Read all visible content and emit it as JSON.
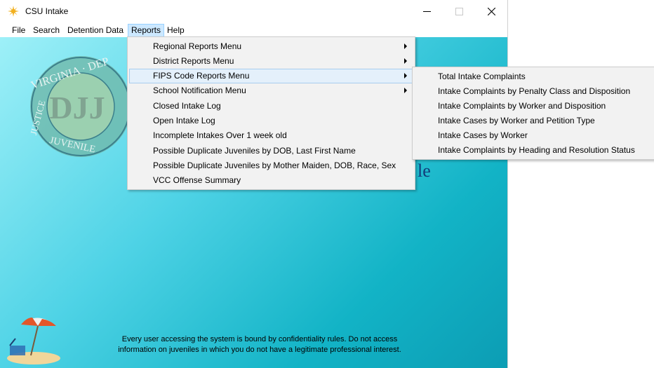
{
  "window": {
    "title": "CSU Intake",
    "minimize_glyph": "—",
    "maximize_glyph": "☐",
    "close_glyph": "✕",
    "app_icon": "sun-icon"
  },
  "menubar": {
    "items": [
      "File",
      "Search",
      "Detention Data",
      "Reports",
      "Help"
    ],
    "active": "Reports"
  },
  "reports_menu": {
    "items": [
      {
        "label": "Regional Reports Menu",
        "submenu": true
      },
      {
        "label": "District Reports Menu",
        "submenu": true
      },
      {
        "label": "FIPS Code Reports Menu",
        "submenu": true,
        "highlighted": true
      },
      {
        "label": "School Notification Menu",
        "submenu": true
      },
      {
        "label": "Closed Intake Log",
        "submenu": false
      },
      {
        "label": "Open Intake Log",
        "submenu": false
      },
      {
        "label": "Incomplete Intakes Over 1 week old",
        "submenu": false
      },
      {
        "label": "Possible Duplicate Juveniles by DOB, Last First Name",
        "submenu": false
      },
      {
        "label": "Possible Duplicate Juveniles by Mother Maiden, DOB, Race, Sex",
        "submenu": false
      },
      {
        "label": "VCC Offense Summary",
        "submenu": false
      }
    ]
  },
  "fips_submenu": {
    "items": [
      "Total Intake Complaints",
      "Intake Complaints by Penalty Class and Disposition",
      "Intake Complaints by Worker and Disposition",
      "Intake Cases by Worker and Petition Type",
      "Intake Cases by Worker",
      "Intake Complaints by Heading and Resolution Status"
    ]
  },
  "background": {
    "welcome_fragment": "le",
    "notice_line1": "Every user accessing the system is bound by confidentiality rules. Do not access",
    "notice_line2": "information on juveniles in which you do not have a legitimate professional interest.",
    "seal_text_top": "VIRGINIA · DEP",
    "seal_text_bottom": "JUVENILE",
    "seal_left": "JUSTICE",
    "seal_letters": "DJJ"
  },
  "colors": {
    "menu_active_bg": "#cce8ff",
    "menu_highlight_bg": "#e4f0fb",
    "content_gradient_start": "#9ef0f8",
    "content_gradient_end": "#0c9db4"
  }
}
